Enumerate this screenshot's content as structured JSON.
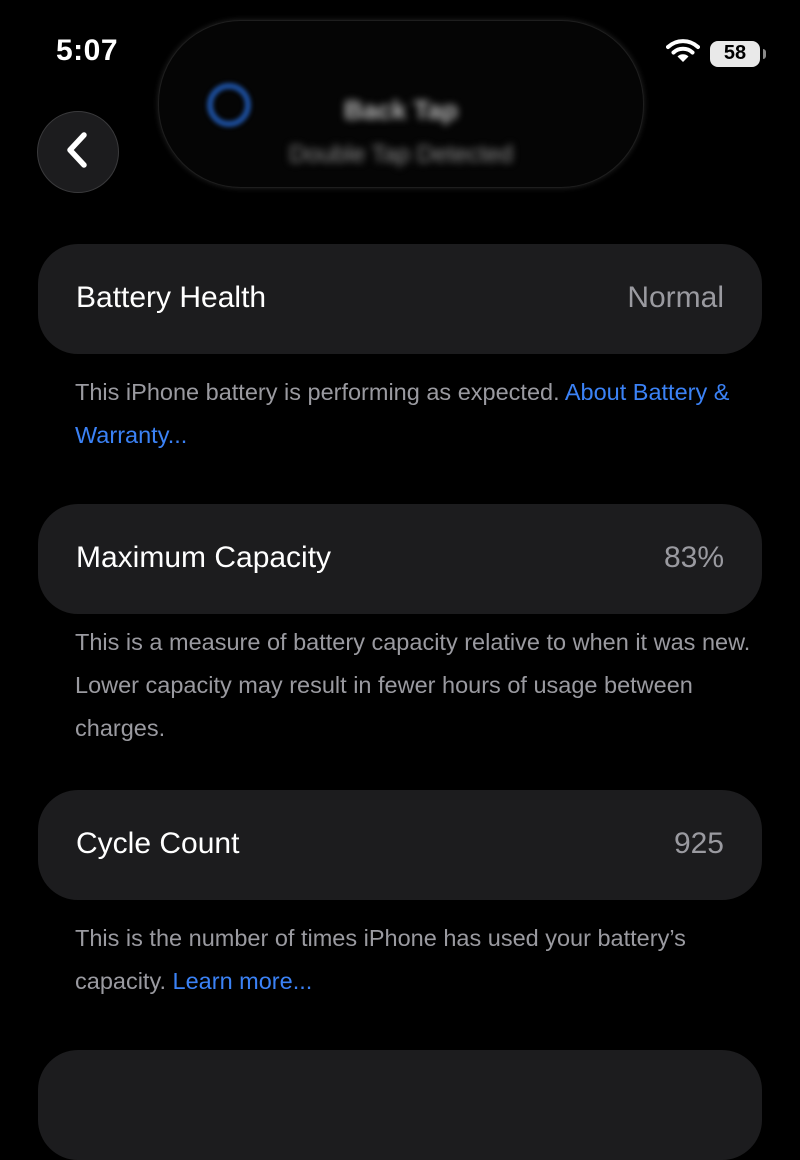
{
  "status_bar": {
    "time": "5:07",
    "battery_level": "58",
    "wifi_icon": "wifi-icon"
  },
  "dynamic_island": {
    "title": "Back Tap",
    "subtitle": "Double Tap Detected",
    "icon": "accessibility-icon"
  },
  "nav": {
    "back_icon": "chevron-left-icon"
  },
  "rows": [
    {
      "label": "Battery Health",
      "value": "Normal",
      "note": "This iPhone battery is performing as expected.",
      "link": "About Battery & Warranty..."
    },
    {
      "label": "Maximum Capacity",
      "value": "83%",
      "note": "This is a measure of battery capacity relative to when it was new. Lower capacity may result in fewer hours of usage between charges."
    },
    {
      "label": "Cycle Count",
      "value": "925",
      "note": "This is the number of times iPhone has used your battery’s capacity.",
      "link": "Learn more..."
    }
  ],
  "colors": {
    "background": "#000000",
    "row_background": "#1c1c1e",
    "secondary_text": "#9a9aa0",
    "link": "#3b82f6"
  }
}
